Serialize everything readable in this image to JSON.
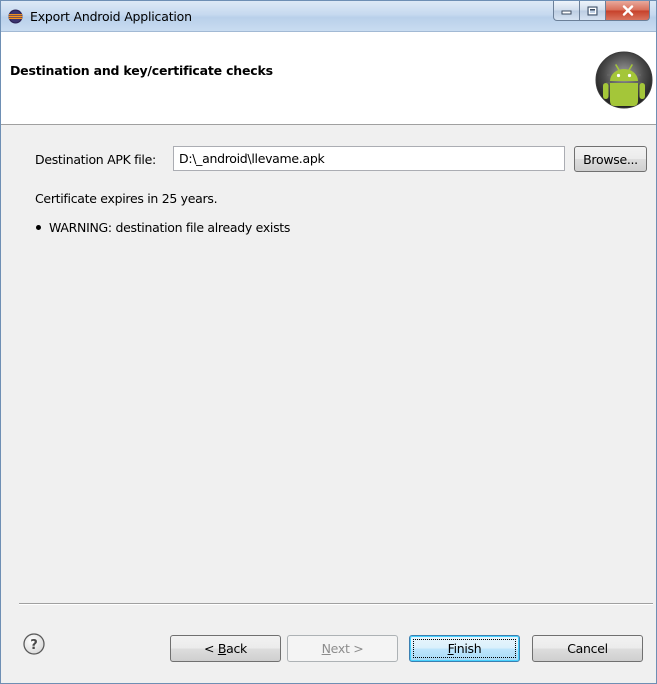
{
  "window": {
    "title": "Export Android Application",
    "icon": "eclipse-icon",
    "controls": [
      "minimize-icon",
      "maximize-icon",
      "close-icon"
    ]
  },
  "header": {
    "title": "Destination and key/certificate checks",
    "logo": "android-logo"
  },
  "destination": {
    "label": "Destination APK file:",
    "value": "D:\\_android\\llevame.apk",
    "browse_label": "Browse..."
  },
  "messages": {
    "certificate": "Certificate expires in 25 years.",
    "warning": "WARNING: destination file already exists"
  },
  "footer": {
    "help_icon": "help-icon",
    "back": {
      "prefix": "< ",
      "mnemonic": "B",
      "rest": "ack",
      "enabled": true
    },
    "next": {
      "mnemonic": "N",
      "rest": "ext >",
      "enabled": false
    },
    "finish": {
      "mnemonic": "F",
      "rest": "inish",
      "enabled": true,
      "default": true
    },
    "cancel": {
      "label": "Cancel",
      "enabled": true
    }
  },
  "colors": {
    "title_bar": "#c6d9ef",
    "dialog_bg": "#f0f0f0",
    "header_bg": "#ffffff",
    "android_green": "#a4c639",
    "close_button": "#c7412a"
  }
}
